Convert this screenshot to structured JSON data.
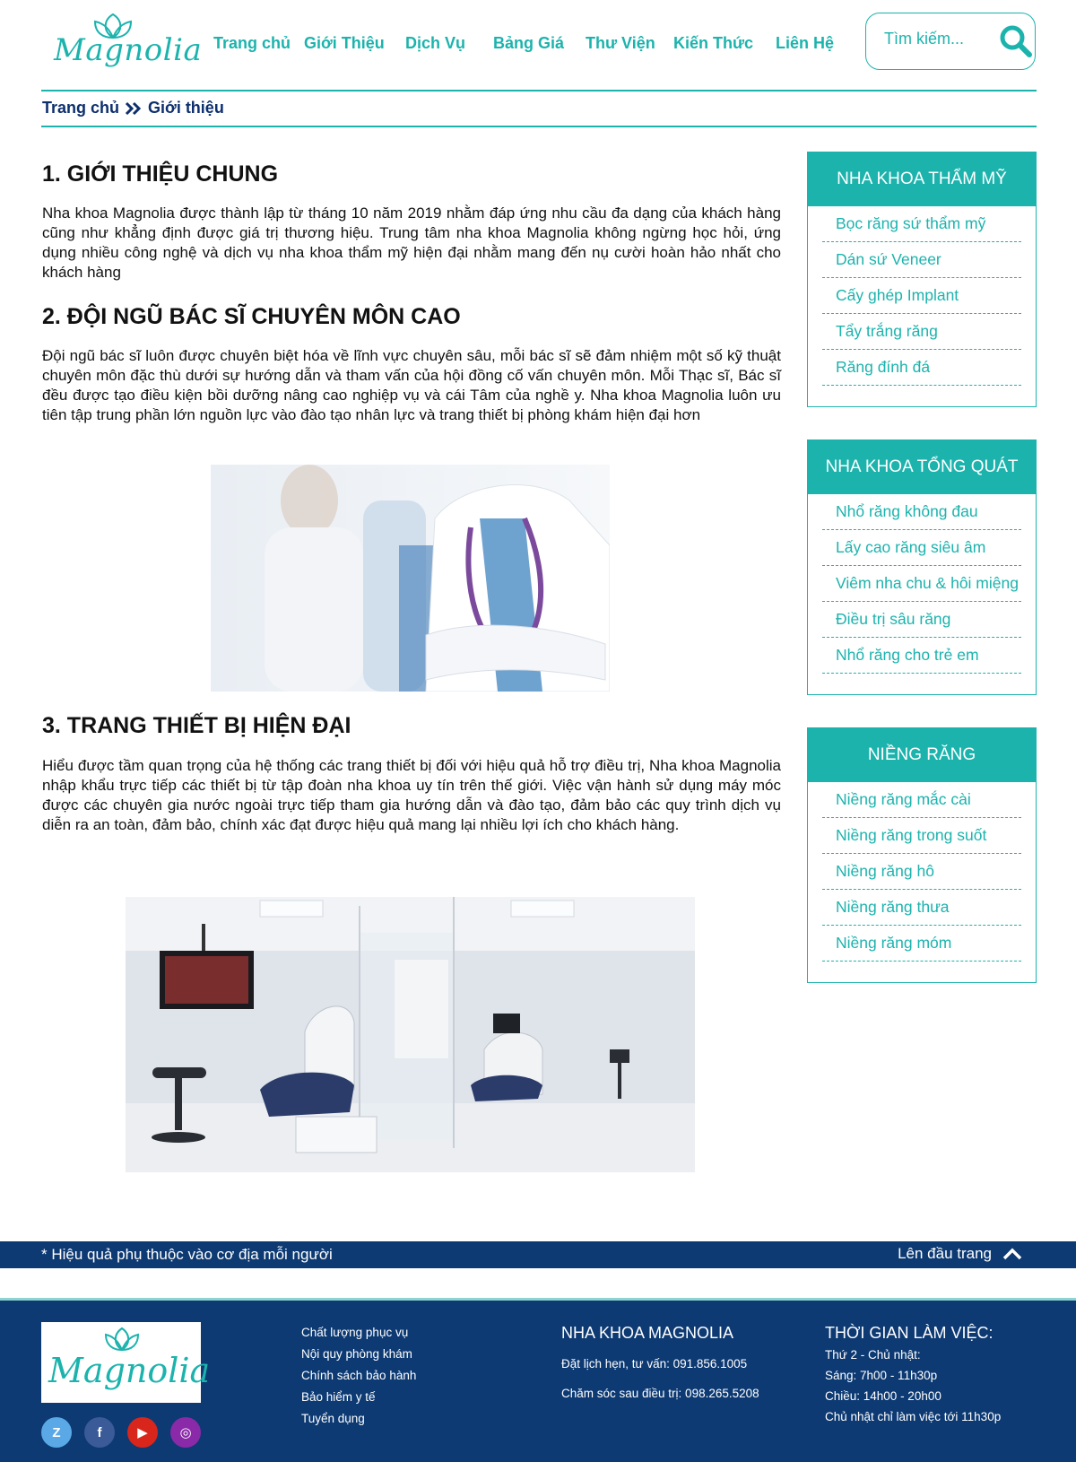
{
  "brand": {
    "logo_text": "Magnolia",
    "accent": "#1cb3ad",
    "navy": "#0d3a73"
  },
  "nav": [
    "Trang chủ",
    "Giới Thiệu",
    "Dịch Vụ",
    "Bảng Giá",
    "Thư Viện",
    "Kiến Thức",
    "Liên Hệ"
  ],
  "search": {
    "placeholder": "Tìm kiếm..."
  },
  "breadcrumb": {
    "home": "Trang chủ",
    "current": "Giới thiệu"
  },
  "sections": [
    {
      "title": "1. GIỚI THIỆU CHUNG",
      "text": "Nha khoa Magnolia được thành lập từ tháng 10 năm 2019 nhằm đáp ứng nhu cầu đa dạng của khách hàng cũng như khẳng định được giá trị thương hiệu. Trung tâm nha khoa Magnolia không ngừng học hỏi, ứng dụng nhiều công nghệ và dịch vụ nha khoa thẩm mỹ hiện đại nhằm mang đến nụ cười hoàn hảo nhất cho khách hàng"
    },
    {
      "title": "2. ĐỘI NGŨ BÁC SĨ CHUYÊN MÔN CAO",
      "text": "Đội ngũ bác sĩ luôn được chuyên biệt hóa về lĩnh vực chuyên sâu, mỗi bác sĩ sẽ đảm nhiệm một số kỹ thuật chuyên môn đặc thù dưới sự hướng dẫn và tham vấn của hội đồng cố vấn chuyên môn. Mỗi Thạc sĩ, Bác sĩ đều được tạo điều kiện bồi dưỡng nâng cao nghiệp vụ và cái Tâm của nghề y. Nha khoa Magnolia luôn ưu tiên tập trung phần lớn nguồn lực vào đào tạo nhân lực và trang thiết bị phòng khám hiện đại hơn"
    },
    {
      "title": "3. TRANG THIẾT BỊ HIỆN ĐẠI",
      "text": "Hiểu được tầm quan trọng của hệ thống các trang thiết bị đối với hiệu quả hỗ trợ điều trị, Nha khoa Magnolia nhập khẩu trực tiếp các thiết bị từ tập đoàn nha khoa uy tín trên thế giới. Việc vận hành sử dụng máy móc được các chuyên gia nước ngoài trực tiếp tham gia hướng dẫn và đào tạo, đảm bảo các quy trình dịch vụ diễn ra an toàn, đảm bảo, chính xác đạt được hiệu quả mang lại nhiều lợi ích cho khách hàng."
    }
  ],
  "sidebar": [
    {
      "title": "NHA KHOA THẨM MỸ",
      "items": [
        "Bọc răng sứ thẩm mỹ",
        "Dán sứ Veneer",
        "Cấy ghép Implant",
        "Tẩy trắng răng",
        "Răng đính đá"
      ]
    },
    {
      "title": "NHA KHOA TỔNG QUÁT",
      "items": [
        "Nhổ răng không đau",
        "Lấy cao răng siêu âm",
        "Viêm nha chu & hôi miệng",
        "Điều trị sâu răng",
        "Nhổ răng cho trẻ em"
      ]
    },
    {
      "title": "NIỀNG RĂNG",
      "items": [
        "Niềng răng mắc cài",
        "Niềng răng trong suốt",
        "Niềng răng hô",
        "Niềng răng thưa",
        "Niềng răng móm"
      ]
    }
  ],
  "note_bar": {
    "note": "* Hiệu quả phụ thuộc vào cơ địa mỗi người",
    "back_to_top": "Lên đầu trang"
  },
  "footer": {
    "links": [
      "Chất lượng phục vụ",
      "Nội quy phòng khám",
      "Chính sách bảo hành",
      "Bảo hiểm y tế",
      "Tuyển dụng"
    ],
    "clinic": {
      "title": "NHA KHOA MAGNOLIA",
      "booking": "Đặt lịch hẹn, tư vấn: 091.856.1005",
      "aftercare": "Chăm sóc sau điều trị: 098.265.5208"
    },
    "hours": {
      "title": "THỜI GIAN LÀM VIỆC:",
      "lines": [
        "Thứ 2 - Chủ nhật:",
        "Sáng: 7h00 - 11h30p",
        "Chiều: 14h00 - 20h00",
        "Chủ nhật chỉ làm việc tới 11h30p"
      ]
    },
    "socials": [
      {
        "name": "zalo-icon",
        "glyph": "Z",
        "color": "#5aa9e6"
      },
      {
        "name": "facebook-icon",
        "glyph": "f",
        "color": "#3b5a98"
      },
      {
        "name": "youtube-icon",
        "glyph": "▶",
        "color": "#d9261c"
      },
      {
        "name": "instagram-icon",
        "glyph": "◎",
        "color": "#8a2aa8"
      }
    ]
  }
}
